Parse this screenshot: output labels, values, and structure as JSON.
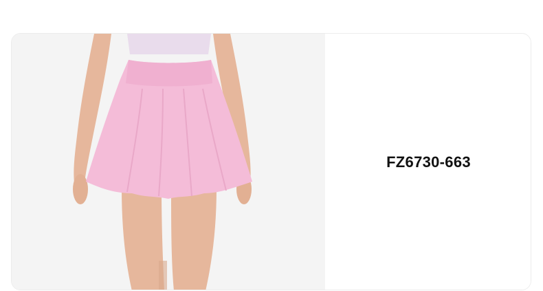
{
  "product": {
    "sku": "FZ6730-663",
    "image_icon": "pink-skirt-product-photo"
  },
  "colors": {
    "background": "#ffffff",
    "photo_background": "#f4f4f4",
    "skirt": "#f4bcd8",
    "top": "#e9dcec",
    "skin": "#e6b79c",
    "text": "#111111"
  }
}
